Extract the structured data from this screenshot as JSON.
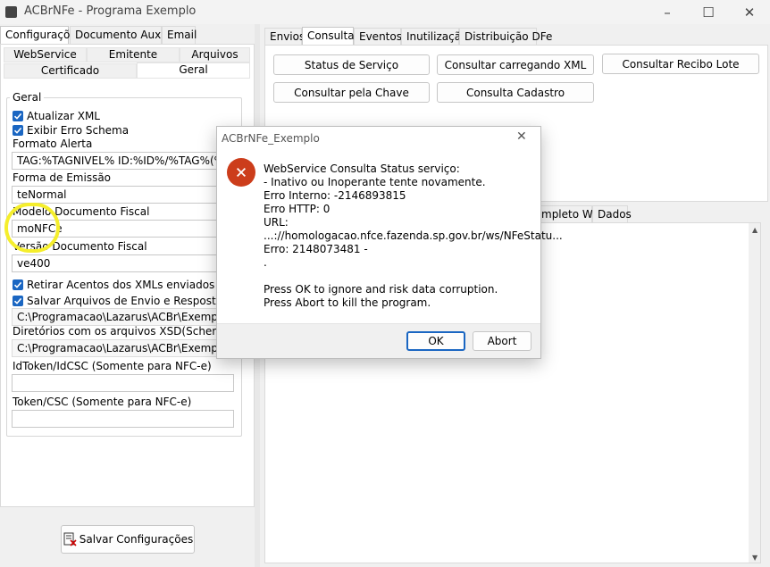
{
  "window": {
    "title": "ACBrNFe - Programa Exemplo",
    "controls": [
      "–",
      "☐",
      "✕"
    ]
  },
  "left_tabs": [
    "Configurações",
    "Documento Auxiliar",
    "Email"
  ],
  "config_subtabs_row1": [
    "WebService",
    "Emitente",
    "Arquivos"
  ],
  "config_subtabs_row2": [
    "Certificado",
    "Geral"
  ],
  "geral": {
    "legend": "Geral",
    "atualizar_xml": "Atualizar XML",
    "exibir_erro_schema": "Exibir Erro Schema",
    "formato_alerta_label": "Formato Alerta",
    "formato_alerta_value": "TAG:%TAGNIVEL% ID:%ID%/%TAG%(%DESC",
    "forma_emissao_label": "Forma de Emissão",
    "forma_emissao_value": "teNormal",
    "modelo_label": "Modelo Documento Fiscal",
    "modelo_value": "moNFCe",
    "versao_label": "Versão Documento Fiscal",
    "versao_value": "ve400",
    "retirar_acentos": "Retirar Acentos dos XMLs enviados",
    "salvar_arquivos": "Salvar Arquivos de Envio e Resposta",
    "salvar_path": "C:\\Programacao\\Lazarus\\ACBr\\Exemplos\\ACBr",
    "xsd_label": "Diretórios com os arquivos XSD(Schemas)",
    "xsd_path": "C:\\Programacao\\Lazarus\\ACBr\\Exemplos\\ACBr",
    "idtoken_label": "IdToken/IdCSC (Somente para NFC-e)",
    "idtoken_value": "",
    "token_label": "Token/CSC (Somente para NFC-e)",
    "token_value": ""
  },
  "save_button": "Salvar Configurações",
  "right_tabs": [
    "Envios",
    "Consultas",
    "Eventos",
    "Inutilização",
    "Distribuição DFe"
  ],
  "consultas_buttons": [
    "Status de Serviço",
    "Consultar carregando XML",
    "Consultar Recibo Lote",
    "Consultar pela Chave",
    "Consulta Cadastro"
  ],
  "lower_tabs": [
    "mpleto WS",
    "Dados"
  ],
  "dialog": {
    "title": "ACBrNFe_Exemplo",
    "lines": [
      "WebService Consulta Status serviço:",
      "- Inativo ou Inoperante tente novamente.",
      "Erro Interno: -2146893815",
      "Erro HTTP: 0",
      "URL:",
      "...://homologacao.nfce.fazenda.sp.gov.br/ws/NFeStatu...",
      "Erro: 2148073481 -",
      "."
    ],
    "prompt1": "Press OK to ignore and risk data corruption.",
    "prompt2": "Press Abort to kill the program.",
    "ok": "OK",
    "abort": "Abort"
  },
  "colors": {
    "accent": "#1a66c2",
    "error": "#cc3d1b",
    "highlight": "#f5ee2c"
  }
}
